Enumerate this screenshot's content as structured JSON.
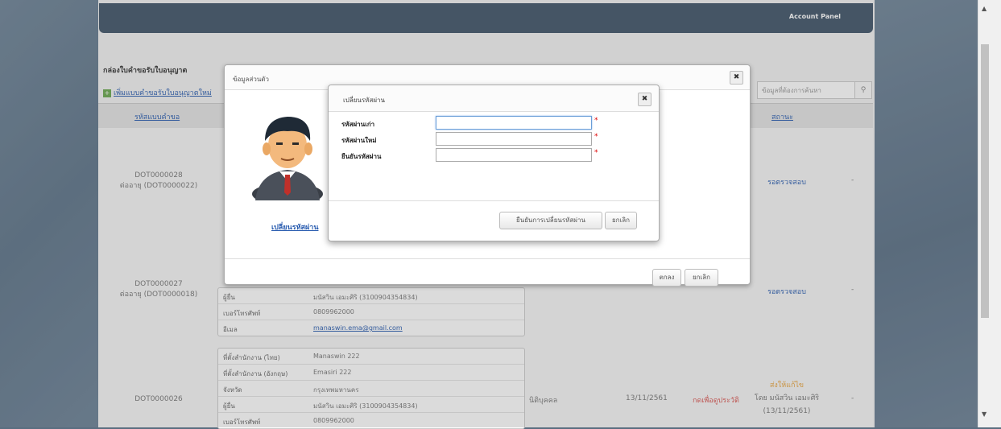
{
  "header": {
    "account_panel": "Account Panel"
  },
  "page": {
    "section_title": "กล่องใบคำขอรับใบอนุญาต",
    "add_link": "เพิ่มแบบคำขอรับใบอนุญาตใหม่",
    "search_placeholder": "ข้อมูลที่ต้องการค้นหา",
    "col_code": "รหัสแบบคำขอ",
    "col_status": "สถานะ"
  },
  "rows": [
    {
      "code": "DOT0000028",
      "ref": "ต่ออายุ (DOT0000022)",
      "status": "รอตรวจสอบ",
      "action": "-"
    },
    {
      "code": "DOT0000027",
      "ref": "ต่ออายุ (DOT0000018)",
      "status": "รอตรวจสอบ",
      "action": "-",
      "details": [
        {
          "label": "ผู้ยื่น",
          "value": "มนัสวิน เอมะศิริ (3100904354834)"
        },
        {
          "label": "เบอร์โทรศัพท์",
          "value": "0809962000"
        },
        {
          "label": "อีเมล",
          "value": "manaswin.ema@gmail.com"
        }
      ]
    },
    {
      "code": "DOT0000026",
      "ref": "",
      "status": "ส่งให้แก้ไข",
      "status_by": "โดย มนัสวิน เอมะศิริ",
      "status_date": "(13/11/2561)",
      "action": "-",
      "type": "นิติบุคคล",
      "date": "13/11/2561",
      "note": "กดเพื่อดูประวัติ",
      "details": [
        {
          "label": "ที่ตั้งสำนักงาน (ไทย)",
          "value": "Manaswin 222"
        },
        {
          "label": "ที่ตั้งสำนักงาน (อังกฤษ)",
          "value": "Emasiri 222"
        },
        {
          "label": "จังหวัด",
          "value": "กรุงเทพมหานคร"
        },
        {
          "label": "ผู้ยื่น",
          "value": "มนัสวิน เอมะศิริ (3100904354834)"
        },
        {
          "label": "เบอร์โทรศัพท์",
          "value": "0809962000"
        }
      ]
    }
  ],
  "profile_dialog": {
    "title": "ข้อมูลส่วนตัว",
    "change_password_link": "เปลี่ยนรหัสผ่าน",
    "ok_label": "ตกลง",
    "cancel_label": "ยกเลิก"
  },
  "password_dialog": {
    "title": "เปลี่ยนรหัสผ่าน",
    "old_label": "รหัสผ่านเก่า",
    "new_label": "รหัสผ่านใหม่",
    "confirm_label": "ยืนยันรหัสผ่าน",
    "old_value": "",
    "new_value": "",
    "confirm_value": "",
    "required_mark": "*",
    "confirm_button": "ยืนยันการเปลี่ยนรหัสผ่าน",
    "cancel_button": "ยกเลิก"
  },
  "colors": {
    "header": "#3f5468",
    "link": "#2a5db0",
    "warning": "#e8a33c",
    "danger": "#d9534f"
  }
}
